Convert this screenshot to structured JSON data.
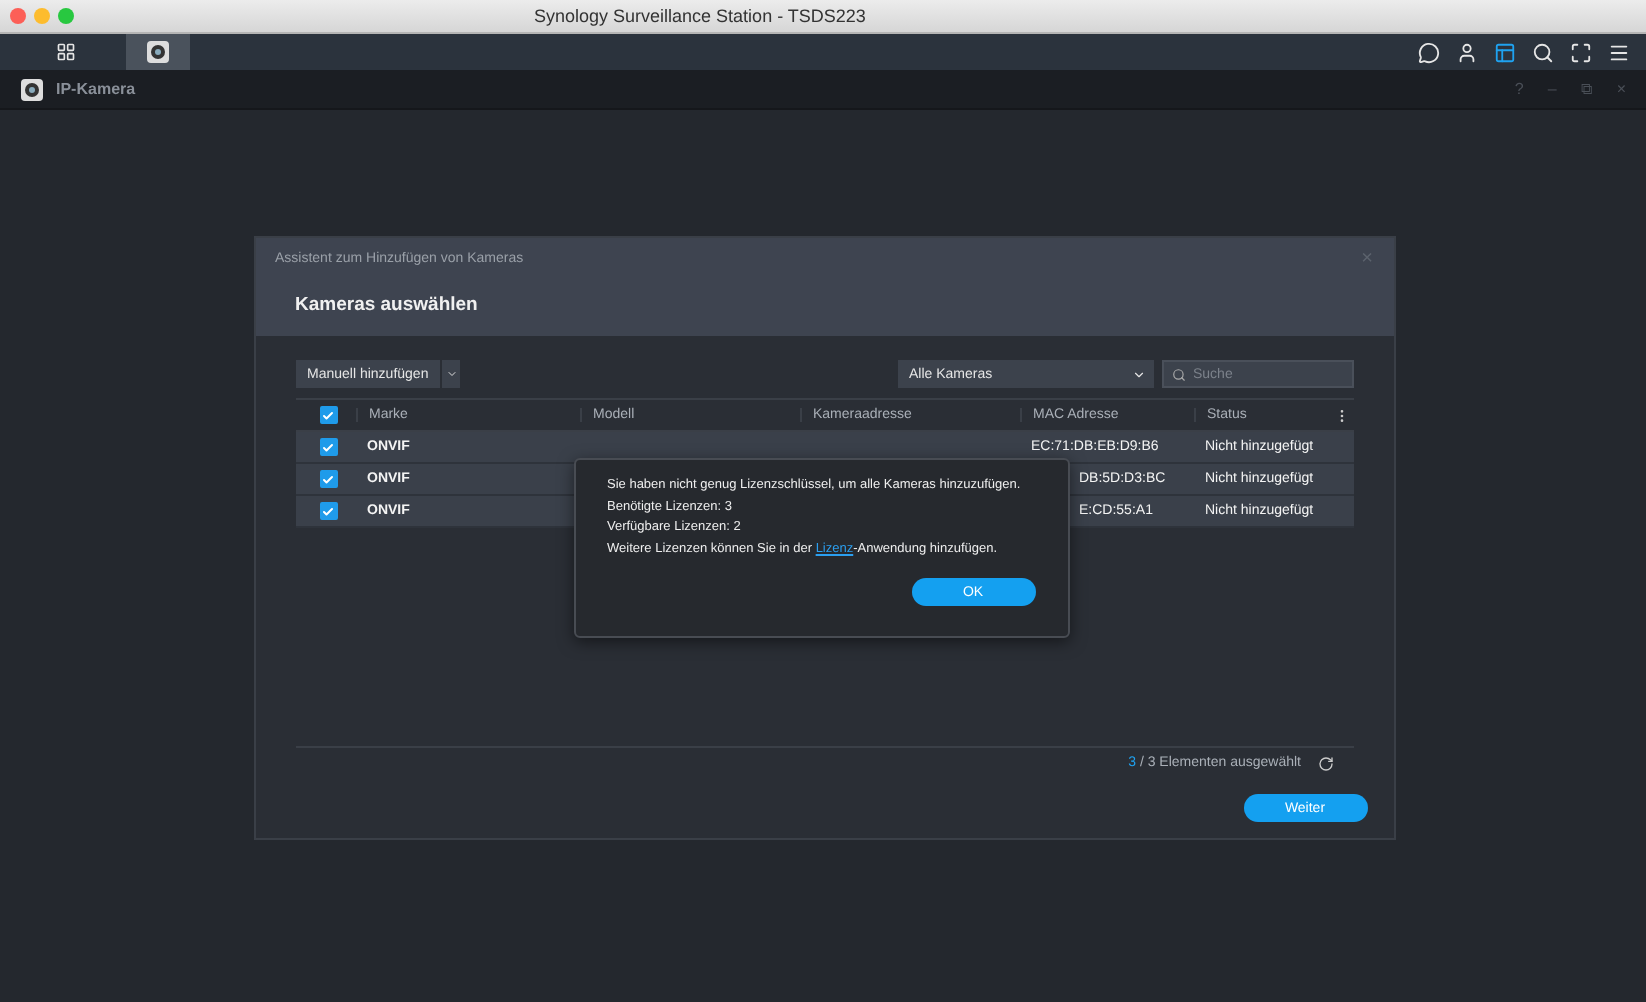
{
  "window": {
    "title": "Synology Surveillance Station - TSDS223"
  },
  "taskbar": {
    "tabs": [
      {
        "kind": "apps",
        "selected": false
      },
      {
        "kind": "camera",
        "selected": true
      }
    ],
    "tools": [
      {
        "kind": "chat",
        "active": false
      },
      {
        "kind": "user",
        "active": false
      },
      {
        "kind": "layout",
        "active": true
      },
      {
        "kind": "search",
        "active": false
      },
      {
        "kind": "fullscreen",
        "active": false
      },
      {
        "kind": "menu",
        "active": false
      }
    ]
  },
  "app_window": {
    "title": "IP-Kamera",
    "controls": [
      "?",
      "–",
      "⧉",
      "×"
    ]
  },
  "wizard": {
    "title": "Assistent zum Hinzufügen von Kameras",
    "close": "×",
    "heading": "Kameras auswählen",
    "add_button": "Manuell hinzufügen",
    "filter": "Alle Kameras",
    "search": {
      "placeholder": "Suche"
    },
    "table": {
      "columns": [
        "Marke",
        "Modell",
        "Kameraadresse",
        "MAC Adresse",
        "Status"
      ],
      "all_checked": true,
      "rows": [
        {
          "checked": true,
          "brand": "ONVIF",
          "mac": {
            "text": "EC:71:DB:EB:D9:B6",
            "cut": false
          },
          "status": "Nicht hinzugefügt"
        },
        {
          "checked": true,
          "brand": "ONVIF",
          "mac": {
            "text": "DB:5D:D3:BC",
            "cut": true
          },
          "status": "Nicht hinzugefügt"
        },
        {
          "checked": true,
          "brand": "ONVIF",
          "mac": {
            "text": "E:CD:55:A1",
            "cut": true
          },
          "status": "Nicht hinzugefügt"
        }
      ]
    },
    "footer": {
      "selected": "3",
      "total": " / 3 Elementen ausgewählt"
    },
    "next_button": "Weiter"
  },
  "dialog": {
    "lines": [
      "Sie haben nicht genug Lizenzschlüssel, um alle Kameras hinzuzufügen.",
      "Benötigte Lizenzen: 3",
      "Verfügbare Lizenzen: 2"
    ],
    "last_line": {
      "before": "Weitere Lizenzen können Sie in der ",
      "link": "Lizenz",
      "after": "-Anwendung hinzufügen."
    },
    "ok_button": "OK"
  }
}
